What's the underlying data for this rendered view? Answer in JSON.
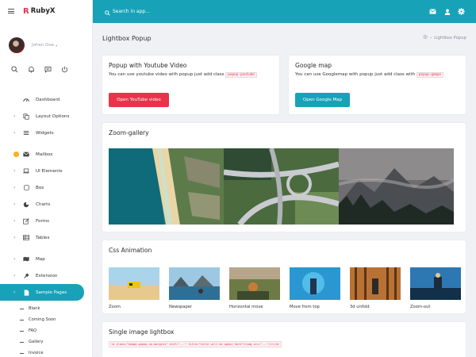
{
  "brand": {
    "mark": "R",
    "name": "RubyX"
  },
  "user": {
    "name": "Johen Doe"
  },
  "search": {
    "placeholder": "Search in app..."
  },
  "sidebar": {
    "groups": [
      [
        {
          "label": "Dashboard",
          "icon": "dashboard-icon",
          "chevron": false
        },
        {
          "label": "Layout Options",
          "icon": "copy-icon",
          "chevron": true
        },
        {
          "label": "Widgets",
          "icon": "list-icon",
          "chevron": true
        }
      ],
      [
        {
          "label": "Mailbox",
          "icon": "mail-icon",
          "chevron": false,
          "dot": true
        },
        {
          "label": "UI Elements",
          "icon": "laptop-icon",
          "chevron": true
        },
        {
          "label": "Box",
          "icon": "square-icon",
          "chevron": true
        },
        {
          "label": "Charts",
          "icon": "pie-chart-icon",
          "chevron": true
        },
        {
          "label": "Forms",
          "icon": "edit-icon",
          "chevron": true
        },
        {
          "label": "Tables",
          "icon": "grid-icon",
          "chevron": true
        }
      ],
      [
        {
          "label": "Map",
          "icon": "map-icon",
          "chevron": true
        },
        {
          "label": "Extension",
          "icon": "plug-icon",
          "chevron": true
        },
        {
          "label": "Sample Pages",
          "icon": "file-icon",
          "chevron": true,
          "active": true
        }
      ]
    ],
    "subitems": [
      "Blank",
      "Coming Soon",
      "FAQ",
      "Gallery",
      "Invoice"
    ]
  },
  "page": {
    "title": "Lightbox Popup",
    "breadcrumb": "Lightbox Popup"
  },
  "youtube_card": {
    "title": "Popup with Youtube Video",
    "text": "You can use youtube video with popup just add class",
    "code": "popup-youtube",
    "button": "Open YouTube video"
  },
  "gmap_card": {
    "title": "Google map",
    "text": "You can use Googlemap with popup just add class with",
    "code": "popup-gmaps",
    "button": "Open Google Map"
  },
  "zoom_gallery": {
    "title": "Zoom-gallery"
  },
  "css_animation": {
    "title": "Css Animation",
    "items": [
      "Zoom",
      "Newspaper",
      "Horizontal move",
      "Move from top",
      "3d unfold",
      "Zoom-out"
    ]
  },
  "single_image": {
    "title": "Single image lightbox",
    "code": "<a class=\"image-popup-no-margins\" href=\"...\" title=\"title will be apear here\"><img src=\"...\"/></a>"
  },
  "colors": {
    "accent": "#17a2b8",
    "danger": "#e8334a",
    "warning": "#f5b21b"
  }
}
